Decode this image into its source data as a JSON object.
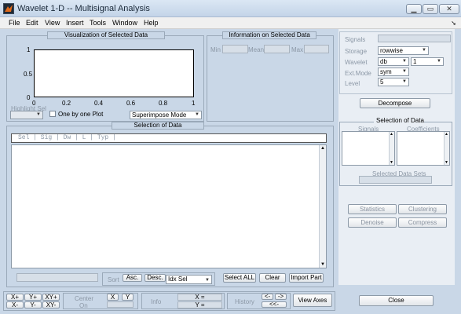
{
  "window": {
    "title": "Wavelet 1-D -- Multisignal Analysis"
  },
  "menu": [
    "File",
    "Edit",
    "View",
    "Insert",
    "Tools",
    "Window",
    "Help"
  ],
  "visualization": {
    "title": "Visualization of Selected Data",
    "y_ticks": [
      "1",
      "0.5",
      "0"
    ],
    "x_ticks": [
      "0",
      "0.2",
      "0.4",
      "0.6",
      "0.8",
      "1"
    ],
    "highlight_label": "Highlight Sel",
    "one_by_one_label": "One by one Plot",
    "mode_select": "Superimpose Mode"
  },
  "info": {
    "title": "Information on Selected Data",
    "min_label": "Min",
    "mean_label": "Mean",
    "max_label": "Max"
  },
  "selection": {
    "title": "Selection of Data",
    "columns_header": "Sel | Sig | Dw | L | Typ |",
    "sort_label": "Sort",
    "asc_label": "Asc.",
    "desc_label": "Desc.",
    "sort_select": "Idx Sel",
    "select_all": "Select ALL",
    "clear": "Clear",
    "import_part": "Import Part"
  },
  "right_panel": {
    "signals_label": "Signals",
    "storage_label": "Storage",
    "storage_value": "rowwise",
    "wavelet_label": "Wavelet",
    "wavelet_family": "db",
    "wavelet_order": "1",
    "extmode_label": "Ext.Mode",
    "extmode_value": "sym",
    "level_label": "Level",
    "level_value": "5",
    "decompose": "Decompose",
    "sel_title": "Selection of Data",
    "signals_col": "Signals",
    "coefficients_col": "Coefficients",
    "selected_sets": "Selected Data Sets",
    "statistics": "Statistics",
    "clustering": "Clustering",
    "denoise": "Denoise",
    "compress": "Compress",
    "close": "Close"
  },
  "bottom": {
    "xplus": "X+",
    "yplus": "Y+",
    "xyplus": "XY+",
    "xminus": "X-",
    "yminus": "Y-",
    "xyminus": "XY-",
    "center_label": "Center",
    "on_label": "On",
    "x_btn": "X",
    "y_btn": "Y",
    "info_label": "Info",
    "x_eq": "X =",
    "y_eq": "Y =",
    "history_label": "History",
    "back": "<-",
    "fwd": "->",
    "back2": "<<-",
    "view_axes": "View Axes"
  }
}
